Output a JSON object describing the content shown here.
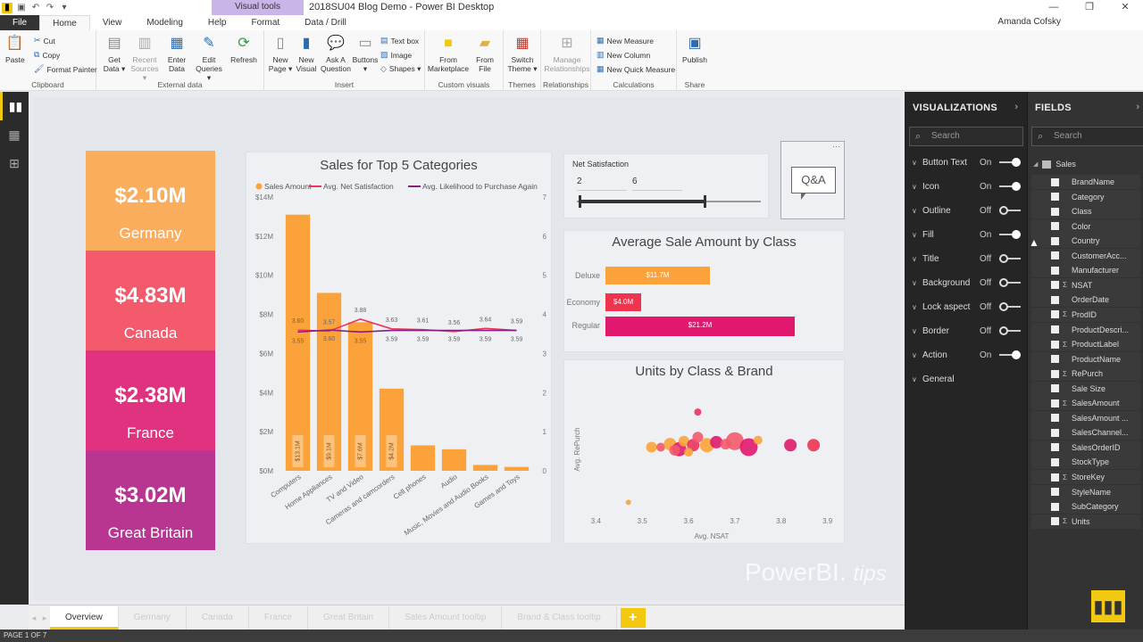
{
  "window": {
    "title": "2018SU04 Blog Demo - Power BI Desktop",
    "contextual_label": "Visual tools",
    "user": "Amanda Cofsky"
  },
  "ribbon_tabs": [
    "File",
    "Home",
    "View",
    "Modeling",
    "Help",
    "Format",
    "Data / Drill"
  ],
  "ribbon": {
    "clipboard": {
      "paste": "Paste",
      "cut": "Cut",
      "copy": "Copy",
      "format_painter": "Format Painter",
      "label": "Clipboard"
    },
    "external": {
      "get_data": "Get Data ▾",
      "recent": "Recent Sources ▾",
      "enter": "Enter Data",
      "edit": "Edit Queries ▾",
      "refresh": "Refresh",
      "label": "External data"
    },
    "insert": {
      "new_page": "New Page ▾",
      "new_visual": "New Visual",
      "ask": "Ask A Question",
      "buttons": "Buttons ▾",
      "text_box": "Text box",
      "image": "Image",
      "shapes": "Shapes ▾",
      "label": "Insert"
    },
    "custom": {
      "from_market": "From Marketplace",
      "from_file": "From File",
      "label": "Custom visuals"
    },
    "themes": {
      "switch": "Switch Theme ▾",
      "label": "Themes"
    },
    "relationships": {
      "manage": "Manage Relationships",
      "label": "Relationships"
    },
    "calculations": {
      "new_measure": "New Measure",
      "new_column": "New Column",
      "new_quick": "New Quick Measure",
      "label": "Calculations"
    },
    "share": {
      "publish": "Publish",
      "label": "Share"
    }
  },
  "kpis": [
    {
      "value": "$2.10M",
      "country": "Germany",
      "color": "#fbad5e"
    },
    {
      "value": "$4.83M",
      "country": "Canada",
      "color": "#f35a6c"
    },
    {
      "value": "$2.38M",
      "country": "France",
      "color": "#e0327f"
    },
    {
      "value": "$3.02M",
      "country": "Great Britain",
      "color": "#b83692"
    }
  ],
  "chart_data": [
    {
      "type": "bar",
      "title": "Sales for Top 5 Categories",
      "legend": [
        "Sales Amount",
        "Avg. Net Satisfaction",
        "Avg. Likelihood to Purchase Again"
      ],
      "categories": [
        "Computers",
        "Home Appliances",
        "TV and Video",
        "Cameras and camcorders",
        "Cell phones",
        "Audio",
        "Music, Movies and Audio Books",
        "Games and Toys"
      ],
      "series": [
        {
          "name": "Sales Amount",
          "values": [
            13.1,
            9.1,
            7.6,
            4.2,
            1.3,
            1.1,
            0.3,
            0.2
          ],
          "bar_labels": [
            "$13.1M",
            "$9.1M",
            "$7.6M",
            "$4.2M",
            "",
            "",
            "",
            ""
          ],
          "color": "#fba33a"
        },
        {
          "name": "Avg. Net Satisfaction",
          "values": [
            3.6,
            3.57,
            3.88,
            3.63,
            3.61,
            3.56,
            3.64,
            3.59
          ],
          "color": "#e8345e"
        },
        {
          "name": "Avg. Likelihood to Purchase Again",
          "values": [
            3.55,
            3.6,
            3.55,
            3.59,
            3.59,
            3.59,
            3.59,
            3.59
          ],
          "color": "#8b1f7a"
        }
      ],
      "y_ticks": [
        "$0M",
        "$2M",
        "$4M",
        "$6M",
        "$8M",
        "$10M",
        "$12M",
        "$14M"
      ],
      "y2_ticks": [
        "0",
        "1",
        "2",
        "3",
        "4",
        "5",
        "6",
        "7"
      ],
      "ylim": [
        0,
        14
      ],
      "y2lim": [
        0,
        7
      ]
    },
    {
      "type": "bar",
      "title": "Average Sale Amount by Class",
      "categories": [
        "Deluxe",
        "Economy",
        "Regular"
      ],
      "values": [
        11.7,
        4.0,
        21.2
      ],
      "labels": [
        "$11.7M",
        "$4.0M",
        "$21.2M"
      ],
      "colors": [
        "#fba33a",
        "#f0334f",
        "#e0196e"
      ],
      "xlim": [
        0,
        25
      ]
    },
    {
      "type": "scatter",
      "title": "Units by Class & Brand",
      "xlabel": "Avg. NSAT",
      "ylabel": "Avg. RePurch",
      "x_ticks": [
        "3.4",
        "3.5",
        "3.6",
        "3.7",
        "3.8",
        "3.9"
      ],
      "xlim": [
        3.38,
        3.92
      ],
      "ylim": [
        3.0,
        4.2
      ],
      "points": [
        {
          "x": 3.47,
          "y": 3.05,
          "r": 3,
          "c": "#fba33a"
        },
        {
          "x": 3.62,
          "y": 3.95,
          "r": 4,
          "c": "#e8345e"
        },
        {
          "x": 3.52,
          "y": 3.6,
          "r": 6,
          "c": "#fba33a"
        },
        {
          "x": 3.54,
          "y": 3.6,
          "r": 5,
          "c": "#f35a6c"
        },
        {
          "x": 3.56,
          "y": 3.63,
          "r": 7,
          "c": "#fba33a"
        },
        {
          "x": 3.58,
          "y": 3.58,
          "r": 8,
          "c": "#e0196e"
        },
        {
          "x": 3.59,
          "y": 3.66,
          "r": 6,
          "c": "#fba33a"
        },
        {
          "x": 3.61,
          "y": 3.62,
          "r": 7,
          "c": "#e8345e"
        },
        {
          "x": 3.62,
          "y": 3.7,
          "r": 6,
          "c": "#f35a6c"
        },
        {
          "x": 3.64,
          "y": 3.62,
          "r": 8,
          "c": "#fba33a"
        },
        {
          "x": 3.66,
          "y": 3.65,
          "r": 7,
          "c": "#e0196e"
        },
        {
          "x": 3.68,
          "y": 3.63,
          "r": 6,
          "c": "#f35a6c"
        },
        {
          "x": 3.7,
          "y": 3.66,
          "r": 10,
          "c": "#f35a6c"
        },
        {
          "x": 3.73,
          "y": 3.6,
          "r": 10,
          "c": "#e0196e"
        },
        {
          "x": 3.75,
          "y": 3.67,
          "r": 5,
          "c": "#fba33a"
        },
        {
          "x": 3.6,
          "y": 3.55,
          "r": 5,
          "c": "#fba33a"
        },
        {
          "x": 3.57,
          "y": 3.57,
          "r": 6,
          "c": "#f35a6c"
        },
        {
          "x": 3.82,
          "y": 3.62,
          "r": 7,
          "c": "#e0196e"
        },
        {
          "x": 3.87,
          "y": 3.62,
          "r": 7,
          "c": "#f0334f"
        }
      ]
    }
  ],
  "slicer": {
    "title": "Net Satisfaction",
    "min": "2",
    "max": "6",
    "range": [
      2,
      6
    ],
    "low": 2,
    "high": 6
  },
  "qna": {
    "label": "Q&A"
  },
  "visualizations": {
    "header": "VISUALIZATIONS",
    "search": "Search",
    "props": [
      {
        "label": "Button Text",
        "state": "On"
      },
      {
        "label": "Icon",
        "state": "On"
      },
      {
        "label": "Outline",
        "state": "Off"
      },
      {
        "label": "Fill",
        "state": "On"
      },
      {
        "label": "Title",
        "state": "Off"
      },
      {
        "label": "Background",
        "state": "Off"
      },
      {
        "label": "Lock aspect",
        "state": "Off"
      },
      {
        "label": "Border",
        "state": "Off"
      },
      {
        "label": "Action",
        "state": "On"
      },
      {
        "label": "General",
        "state": ""
      }
    ]
  },
  "fields_pane": {
    "header": "FIELDS",
    "search": "Search",
    "table": "Sales",
    "fields": [
      {
        "name": "BrandName",
        "sigma": false
      },
      {
        "name": "Category",
        "sigma": false
      },
      {
        "name": "Class",
        "sigma": false
      },
      {
        "name": "Color",
        "sigma": false
      },
      {
        "name": "Country",
        "sigma": false
      },
      {
        "name": "CustomerAcc...",
        "sigma": false
      },
      {
        "name": "Manufacturer",
        "sigma": false
      },
      {
        "name": "NSAT",
        "sigma": true
      },
      {
        "name": "OrderDate",
        "sigma": false
      },
      {
        "name": "ProdID",
        "sigma": true
      },
      {
        "name": "ProductDescri...",
        "sigma": false
      },
      {
        "name": "ProductLabel",
        "sigma": true
      },
      {
        "name": "ProductName",
        "sigma": false
      },
      {
        "name": "RePurch",
        "sigma": true
      },
      {
        "name": "Sale Size",
        "sigma": false
      },
      {
        "name": "SalesAmount",
        "sigma": true
      },
      {
        "name": "SalesAmount ...",
        "sigma": false
      },
      {
        "name": "SalesChannel...",
        "sigma": false
      },
      {
        "name": "SalesOrderID",
        "sigma": false
      },
      {
        "name": "StockType",
        "sigma": false
      },
      {
        "name": "StoreKey",
        "sigma": true
      },
      {
        "name": "StyleName",
        "sigma": false
      },
      {
        "name": "SubCategory",
        "sigma": false
      },
      {
        "name": "Units",
        "sigma": true
      }
    ]
  },
  "pages": [
    "Overview",
    "Germany",
    "Canada",
    "France",
    "Great Britain",
    "Sales Amount tooltip",
    "Brand & Class tooltip"
  ],
  "add_page": "+",
  "status": "PAGE 1 OF 7",
  "watermark": {
    "main": "PowerBI.",
    "sub": "tips"
  }
}
